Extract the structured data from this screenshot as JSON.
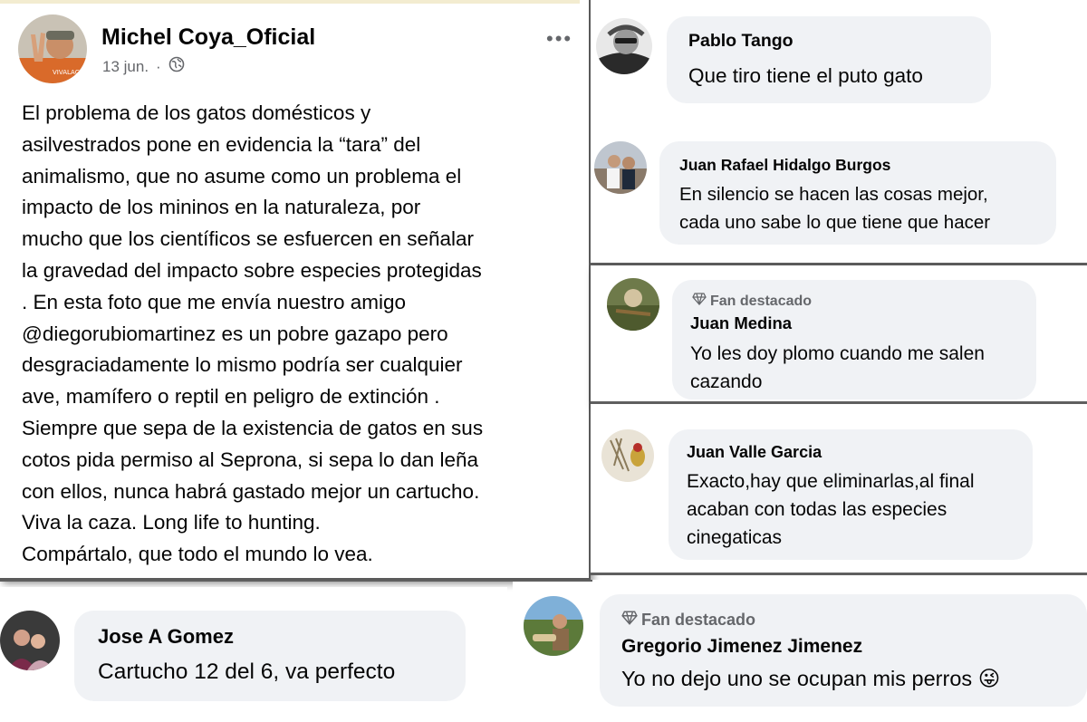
{
  "post": {
    "author": "Michel Coya_Oficial",
    "date": "13 jun.",
    "date_separator": "·",
    "avatar_caption": "VIVALACAZA",
    "more_icon": "more-horizontal-icon",
    "audience_icon": "globe-icon",
    "body": "El problema de los gatos domésticos y\nasilvestrados pone en evidencia la “tara” del\nanimalismo, que no asume como un problema el\nimpacto de los mininos en la naturaleza, por\nmucho que los científicos se esfuercen en señalar\nla gravedad del impacto sobre especies protegidas\n. En esta foto que me envía nuestro amigo\n@diegorubiomartinez es un pobre gazapo pero\ndesgraciadamente lo mismo podría ser cualquier\nave, mamífero o reptil en peligro de extinción .\nSiempre que sepa de la existencia de gatos en sus\ncotos pida permiso al Seprona, si sepa lo dan leña\ncon ellos, nunca habrá gastado mejor un cartucho.\nViva la caza. Long life to hunting.\nCompártalo, que todo el mundo lo vea."
  },
  "comments": {
    "pablo": {
      "name": "Pablo Tango",
      "text": "Que tiro tiene el puto gato"
    },
    "juan_rafael": {
      "name": "Juan Rafael Hidalgo Burgos",
      "text": "En silencio se hacen las cosas mejor,\ncada uno sabe lo que tiene que hacer"
    },
    "juan_medina": {
      "badge": "Fan destacado",
      "name": "Juan Medina",
      "text": "Yo les doy plomo cuando me salen\ncazando"
    },
    "juan_valle": {
      "name": "Juan Valle Garcia",
      "text": "Exacto,hay que eliminarlas,al final\nacaban con todas las especies\ncinegaticas"
    },
    "jose": {
      "name": "Jose A Gomez",
      "text": "Cartucho 12 del 6, va perfecto"
    },
    "gregorio": {
      "badge": "Fan destacado",
      "name": "Gregorio Jimenez Jimenez",
      "text": "Yo no dejo uno se ocupan mis perros",
      "emoji": "😜"
    }
  },
  "colors": {
    "bubble": "#f0f2f5",
    "meta": "#65676b",
    "text": "#050505"
  }
}
